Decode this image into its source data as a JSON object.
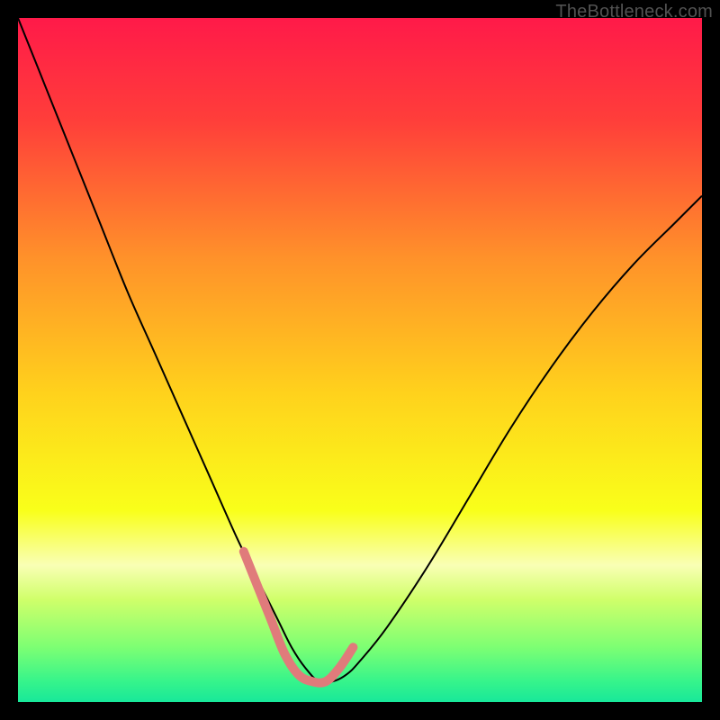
{
  "watermark": "TheBottleneck.com",
  "chart_data": {
    "type": "line",
    "title": "",
    "xlabel": "",
    "ylabel": "",
    "xlim": [
      0,
      100
    ],
    "ylim": [
      0,
      100
    ],
    "grid": false,
    "legend": false,
    "background_gradient": {
      "stops": [
        {
          "offset": 0.0,
          "color": "#ff1a49"
        },
        {
          "offset": 0.15,
          "color": "#ff3e3a"
        },
        {
          "offset": 0.35,
          "color": "#ff912a"
        },
        {
          "offset": 0.55,
          "color": "#ffd21c"
        },
        {
          "offset": 0.72,
          "color": "#f9ff1a"
        },
        {
          "offset": 0.8,
          "color": "#f9ffb5"
        },
        {
          "offset": 0.85,
          "color": "#d0ff6a"
        },
        {
          "offset": 0.92,
          "color": "#7dff73"
        },
        {
          "offset": 0.97,
          "color": "#36f48b"
        },
        {
          "offset": 1.0,
          "color": "#18e89a"
        }
      ]
    },
    "series": [
      {
        "name": "bottleneck-curve",
        "stroke": "#000000",
        "width": 2,
        "x": [
          0,
          4,
          8,
          12,
          16,
          20,
          24,
          28,
          32,
          34,
          36,
          38,
          40,
          42,
          44,
          46,
          48,
          50,
          54,
          60,
          66,
          72,
          78,
          84,
          90,
          96,
          100
        ],
        "y": [
          100,
          90,
          80,
          70,
          60,
          51,
          42,
          33,
          24,
          20,
          16,
          12,
          8,
          5,
          3,
          3,
          4,
          6,
          11,
          20,
          30,
          40,
          49,
          57,
          64,
          70,
          74
        ]
      },
      {
        "name": "highlight-band",
        "stroke": "#e07b7b",
        "width": 10,
        "linecap": "round",
        "x": [
          33,
          35,
          37,
          39,
          41,
          43,
          45,
          47,
          49
        ],
        "y": [
          22,
          17,
          12,
          7,
          4,
          3,
          3,
          5,
          8
        ]
      }
    ]
  }
}
